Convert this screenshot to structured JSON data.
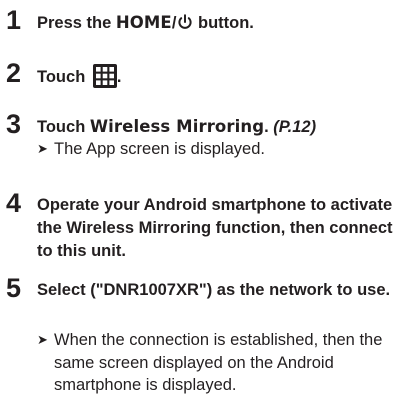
{
  "steps": [
    {
      "number": "1",
      "pre": "Press the ",
      "keyword": "HOME",
      "separator": "/",
      "post": " button.",
      "icon": "power-icon"
    },
    {
      "number": "2",
      "pre": "Touch ",
      "post": ".",
      "icon": "app-grid-icon",
      "icon_color": "#231f20"
    },
    {
      "number": "3",
      "pre": "Touch ",
      "keyword": "Wireless Mirroring",
      "post": ". ",
      "reference": "(P.12)",
      "result": "The App screen is displayed."
    },
    {
      "number": "4",
      "text": "Operate your Android smartphone to activate the Wireless Mirroring function, then connect to this unit."
    },
    {
      "number": "5",
      "text": "Select (\"DNR1007XR\") as the network to use.",
      "result": "When the connection is established, then the same screen displayed on the Android smartphone is displayed."
    }
  ],
  "result_marker": "➤"
}
